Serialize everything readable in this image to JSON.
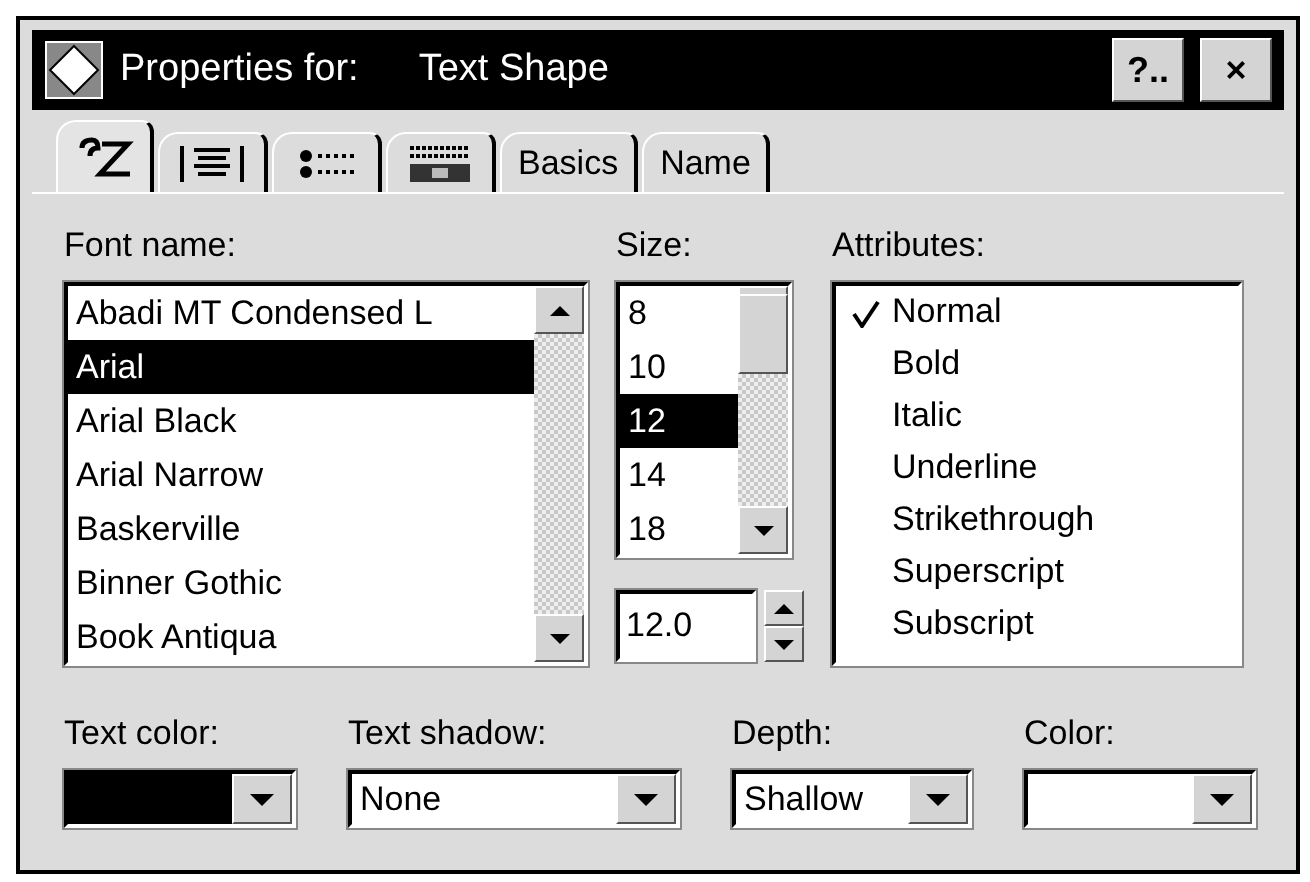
{
  "window": {
    "title_prefix": "Properties for:",
    "title": "Text Shape",
    "buttons": [
      "?..",
      "×"
    ]
  },
  "tabs": [
    {
      "selected": true
    },
    {
      "selected": false
    },
    {
      "selected": false
    },
    {
      "selected": false
    },
    {
      "label": "Basics",
      "selected": false
    },
    {
      "label": "Name",
      "selected": false
    }
  ],
  "font_name": {
    "label": "Font name:",
    "items": [
      {
        "text": "Abadi MT Condensed L",
        "selected": false
      },
      {
        "text": "Arial",
        "selected": true
      },
      {
        "text": "Arial Black",
        "selected": false
      },
      {
        "text": "Arial Narrow",
        "selected": false
      },
      {
        "text": "Baskerville",
        "selected": false
      },
      {
        "text": "Binner Gothic",
        "selected": false
      },
      {
        "text": "Book Antiqua",
        "selected": false
      }
    ]
  },
  "size": {
    "label": "Size:",
    "items": [
      {
        "text": "8",
        "selected": false
      },
      {
        "text": "10",
        "selected": false
      },
      {
        "text": "12",
        "selected": true
      },
      {
        "text": "14",
        "selected": false
      },
      {
        "text": "18",
        "selected": false
      }
    ],
    "value": "12.0"
  },
  "attributes": {
    "label": "Attributes:",
    "items": [
      {
        "text": "Normal",
        "checked": true
      },
      {
        "text": "Bold",
        "checked": false
      },
      {
        "text": "Italic",
        "checked": false
      },
      {
        "text": "Underline",
        "checked": false
      },
      {
        "text": "Strikethrough",
        "checked": false
      },
      {
        "text": "Superscript",
        "checked": false
      },
      {
        "text": "Subscript",
        "checked": false
      }
    ]
  },
  "dropdowns": [
    {
      "label": "Text color:",
      "kind": "swatch",
      "color": "#000000"
    },
    {
      "label": "Text shadow:",
      "kind": "text",
      "value": "None"
    },
    {
      "label": "Depth:",
      "kind": "text",
      "value": "Shallow"
    },
    {
      "label": "Color:",
      "kind": "swatch",
      "color": "#ffffff"
    }
  ]
}
